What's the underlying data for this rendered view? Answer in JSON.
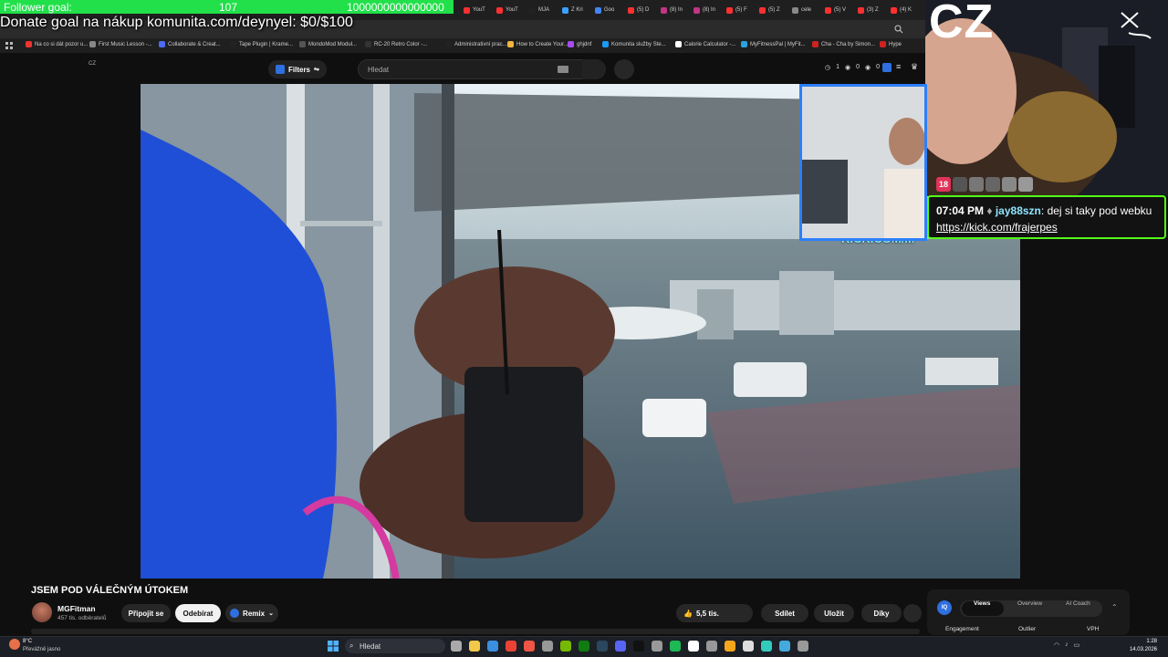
{
  "overlay": {
    "follower_label": "Follower goal:",
    "follower_count": "107",
    "follower_goal": "1000000000000000",
    "donate": "Donate goal na nákup komunita.com/deynyel: $0/$100",
    "cz_logo": "CZ"
  },
  "tabs": [
    "YouT",
    "YouT",
    "MJA",
    "Z Kri",
    "Goo",
    "(5) D",
    "(8) In",
    "(8) In",
    "(5) F",
    "(5) Z",
    "cele",
    "(5) V",
    "(3) Z",
    "(4) K"
  ],
  "bookmarks": [
    "Na co si dát pozor u...",
    "First Music Lesson -...",
    "Collaborate & Creat...",
    "Tape Plugin | Krame...",
    "MondoMod Modul...",
    "RC-20 Retro Color -...",
    "Administrativní prac...",
    "How to Create Your...",
    "ghjdnf",
    "Komunita služby Ste...",
    "Calorie Calculator -...",
    "MyFitnessPal | MyFit...",
    "Cha - Cha by Simon...",
    "Hype"
  ],
  "youtube": {
    "country": "CZ",
    "filters_label": "Filters",
    "search_placeholder": "Hledat",
    "header_counts": [
      "1",
      "0",
      "0"
    ]
  },
  "video": {
    "title": "JSEM POD VÁLEČNÝM ÚTOKEM",
    "channel": "MGFitman",
    "subscribers": "457 tis. odběratelů",
    "join_label": "Připojit se",
    "subscribe_label": "Odebírat",
    "remix_label": "Remix",
    "likes": "5,5 tis.",
    "share_label": "Sdílet",
    "save_label": "Uložit",
    "thanks_label": "Díky",
    "watermark": "KICK.COM/M"
  },
  "chat": {
    "time": "07:04 PM",
    "user": "jay88szn",
    "message": "dej si taky pod webku",
    "link": "https://kick.com/frajerpes",
    "badge_age": "18"
  },
  "vidiq": {
    "tabs": [
      "Views",
      "Overview",
      "AI Coach"
    ],
    "columns": [
      "Engagement",
      "Outlier",
      "VPH"
    ]
  },
  "taskbar": {
    "weather_temp": "8°C",
    "weather_desc": "Převážně jasno",
    "search_label": "Hledat",
    "time": "1:28",
    "date": "14.03.2026"
  }
}
